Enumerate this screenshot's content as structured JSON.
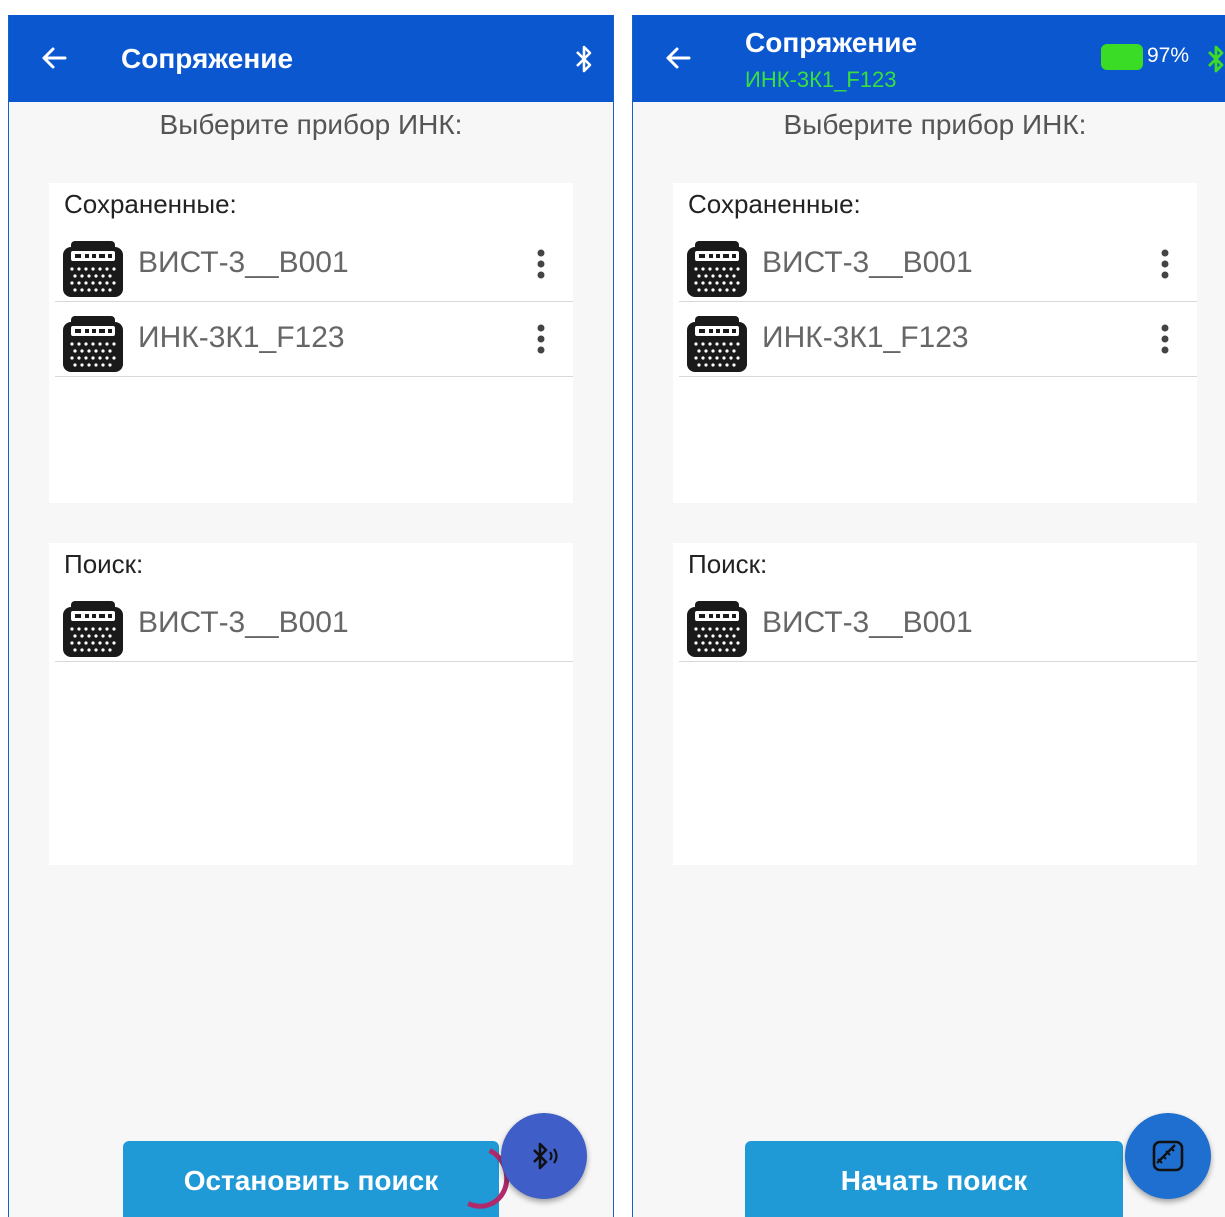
{
  "left": {
    "appbar": {
      "title": "Сопряжение"
    },
    "prompt": "Выберите прибор ИНК:",
    "saved": {
      "title": "Сохраненные:",
      "items": [
        {
          "name": "ВИСТ-3__B001"
        },
        {
          "name": "ИНК-3К1_F123"
        }
      ]
    },
    "search": {
      "title": "Поиск:",
      "items": [
        {
          "name": "ВИСТ-3__B001"
        }
      ]
    },
    "action_button": "Остановить поиск",
    "fab_icon": "bluetooth-searching-icon"
  },
  "right": {
    "appbar": {
      "title": "Сопряжение",
      "subtitle": "ИНК-3К1_F123",
      "battery": "97%"
    },
    "prompt": "Выберите прибор ИНК:",
    "saved": {
      "title": "Сохраненные:",
      "items": [
        {
          "name": "ВИСТ-3__B001"
        },
        {
          "name": "ИНК-3К1_F123"
        }
      ]
    },
    "search": {
      "title": "Поиск:",
      "items": [
        {
          "name": "ВИСТ-3__B001"
        }
      ]
    },
    "action_button": "Начать поиск",
    "fab_icon": "measure-tool-icon"
  },
  "colors": {
    "appbar": "#0b57cf",
    "button": "#1f9ad6",
    "fab": "#3f5ec8",
    "connected_text": "#37e03c",
    "battery": "#3bdc25"
  }
}
